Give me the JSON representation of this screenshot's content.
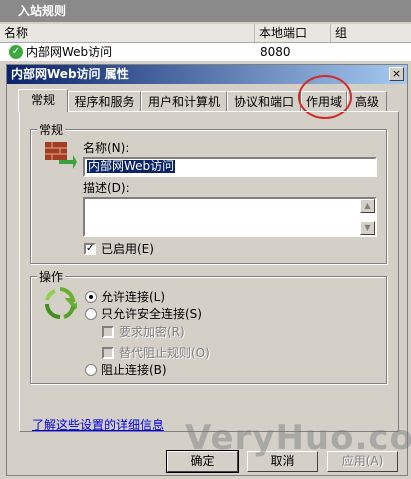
{
  "background_window": {
    "title": "入站规则",
    "columns": [
      "名称",
      "本地端口",
      "组"
    ],
    "row": {
      "name": "内部网Web访问",
      "port": "8080",
      "status_icon": "check-icon"
    }
  },
  "dialog": {
    "title": "内部网Web访问 属性",
    "close_label": "×",
    "tabs": [
      "常规",
      "程序和服务",
      "用户和计算机",
      "协议和端口",
      "作用域",
      "高级"
    ],
    "active_tab": "常规",
    "general": {
      "group_label": "常规",
      "name_label": "名称(N):",
      "name_value": "内部网Web访问",
      "description_label": "描述(D):",
      "description_value": "",
      "enabled_label": "已启用(E)",
      "enabled": true
    },
    "action": {
      "group_label": "操作",
      "options": [
        {
          "label": "允许连接(L)",
          "checked": true
        },
        {
          "label": "只允许安全连接(S)",
          "checked": false
        },
        {
          "label": "阻止连接(B)",
          "checked": false
        }
      ],
      "sub_options": [
        {
          "label": "要求加密(R)",
          "enabled": false,
          "checked": false
        },
        {
          "label": "替代阻止规则(O)",
          "enabled": false,
          "checked": false
        }
      ]
    },
    "link_text": "了解这些设置的详细信息",
    "buttons": {
      "ok": "确定",
      "cancel": "取消",
      "apply": "应用(A)"
    }
  },
  "watermark_text": "VeryHuo.com",
  "colors": {
    "titlebar_start": "#0a246a",
    "titlebar_end": "#a6caf0",
    "highlight_circle": "#d42a2a"
  }
}
